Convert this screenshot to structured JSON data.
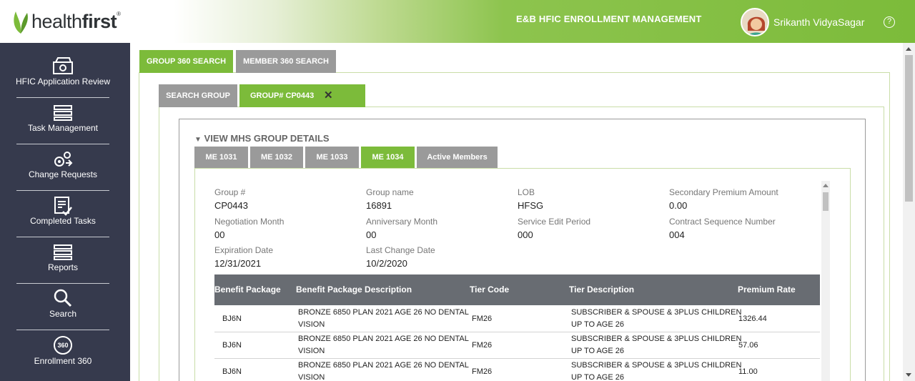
{
  "brand": {
    "logo_light": "health",
    "logo_bold": "first",
    "logo_mark": "®",
    "leaf_icon": "leaf-icon"
  },
  "header": {
    "app_title": "E&B HFIC ENROLLMENT MANAGEMENT",
    "user_name": "Srikanth VidyaSagar",
    "help_icon": "?"
  },
  "sidebar": {
    "items": [
      {
        "label": "HFIC Application Review",
        "icon": "application-review-icon"
      },
      {
        "label": "Task Management",
        "icon": "task-management-icon"
      },
      {
        "label": "Change Requests",
        "icon": "change-requests-icon"
      },
      {
        "label": "Completed Tasks",
        "icon": "completed-tasks-icon"
      },
      {
        "label": "Reports",
        "icon": "reports-icon"
      },
      {
        "label": "Search",
        "icon": "search-icon"
      },
      {
        "label": "Enrollment 360",
        "icon": "enrollment-360-icon",
        "icon_text": "360"
      }
    ]
  },
  "top_tabs": [
    {
      "label": "GROUP 360 SEARCH",
      "active": true
    },
    {
      "label": "MEMBER 360 SEARCH",
      "active": false
    }
  ],
  "sub_tabs": [
    {
      "label": "SEARCH GROUP",
      "active": false
    },
    {
      "label": "GROUP# CP0443",
      "active": true,
      "close": "✕"
    }
  ],
  "section": {
    "toggle": "▼",
    "title": "VIEW MHS GROUP DETAILS"
  },
  "me_tabs": [
    {
      "label": "ME 1031",
      "active": false
    },
    {
      "label": "ME 1032",
      "active": false
    },
    {
      "label": "ME 1033",
      "active": false
    },
    {
      "label": "ME 1034",
      "active": true
    },
    {
      "label": "Active Members",
      "active": false
    }
  ],
  "fields": {
    "group_num": {
      "label": "Group #",
      "value": "CP0443"
    },
    "group_name": {
      "label": "Group name",
      "value": "16891"
    },
    "lob": {
      "label": "LOB",
      "value": "HFSG"
    },
    "secondary_premium": {
      "label": "Secondary Premium Amount",
      "value": "0.00"
    },
    "negotiation_month": {
      "label": "Negotiation Month",
      "value": "00"
    },
    "anniversary_month": {
      "label": "Anniversary Month",
      "value": "00"
    },
    "service_edit_period": {
      "label": "Service Edit Period",
      "value": "000"
    },
    "contract_sequence": {
      "label": "Contract Sequence Number",
      "value": "004"
    },
    "expiration_date": {
      "label": "Expiration Date",
      "value": "12/31/2021"
    },
    "last_change_date": {
      "label": "Last Change Date",
      "value": "10/2/2020"
    }
  },
  "table": {
    "columns": [
      "Benefit Package",
      "Benefit Package Description",
      "Tier Code",
      "Tier Description",
      "Premium Rate"
    ],
    "rows": [
      {
        "package": "BJ6N",
        "desc1": "BRONZE 6850 PLAN 2021 AGE 26 NO DENTAL",
        "desc2": "VISION",
        "tier": "FM26",
        "tdesc1": "SUBSCRIBER & SPOUSE & 3PLUS CHILDREN",
        "tdesc2": "UP TO AGE 26",
        "rate": "1326.44"
      },
      {
        "package": "BJ6N",
        "desc1": "BRONZE 6850 PLAN 2021 AGE 26 NO DENTAL",
        "desc2": "VISION",
        "tier": "FM26",
        "tdesc1": "SUBSCRIBER & SPOUSE & 3PLUS CHILDREN",
        "tdesc2": "UP TO AGE 26",
        "rate": "57.06"
      },
      {
        "package": "BJ6N",
        "desc1": "BRONZE 6850 PLAN 2021 AGE 26 NO DENTAL",
        "desc2": "VISION",
        "tier": "FM26",
        "tdesc1": "SUBSCRIBER & SPOUSE & 3PLUS CHILDREN",
        "tdesc2": "UP TO AGE 26",
        "rate": "11.00"
      }
    ]
  },
  "colors": {
    "accent": "#7cbb3a",
    "sidebar": "#363a4d",
    "tab_inactive": "#9a9a9a",
    "table_header": "#686c72"
  }
}
